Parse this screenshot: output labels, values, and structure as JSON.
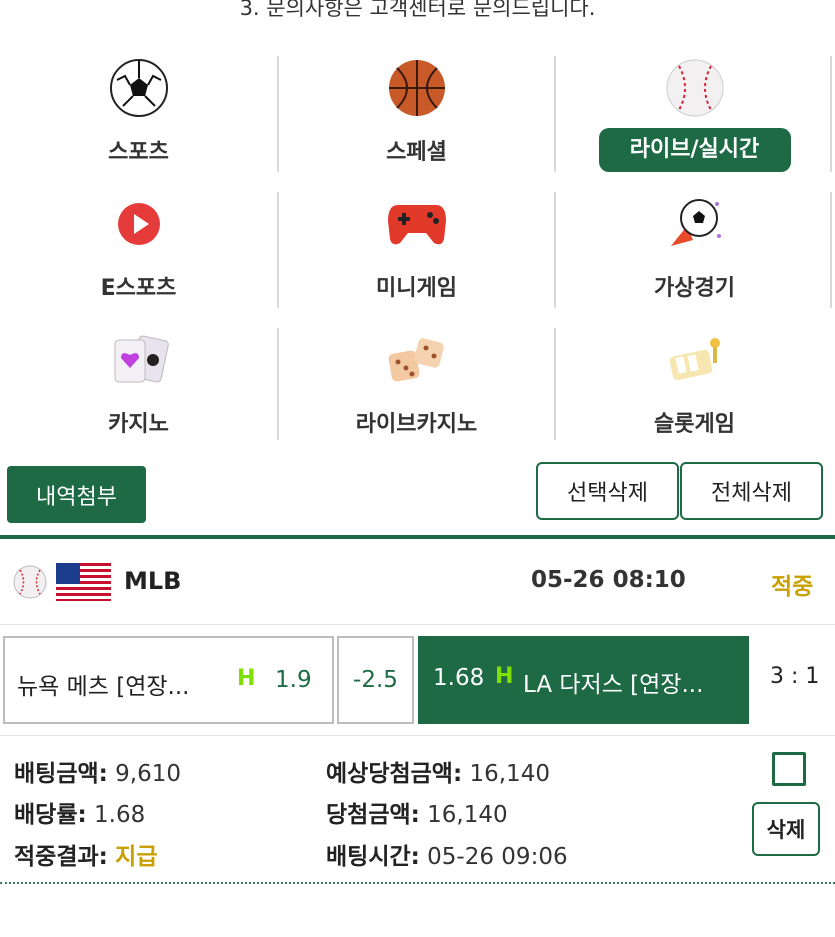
{
  "notice": "3. 문의사항은 고객센터로 문의드립니다.",
  "categories": [
    {
      "label": "스포츠",
      "icon": "soccer-ball-icon",
      "active": false
    },
    {
      "label": "스페셜",
      "icon": "basketball-icon",
      "active": false
    },
    {
      "label": "라이브/실시간",
      "icon": "baseball-icon",
      "active": true
    },
    {
      "label": "E스포츠",
      "icon": "play-icon",
      "active": false
    },
    {
      "label": "미니게임",
      "icon": "gamepad-icon",
      "active": false
    },
    {
      "label": "가상경기",
      "icon": "virtual-soccer-icon",
      "active": false
    },
    {
      "label": "카지노",
      "icon": "cards-icon",
      "active": false
    },
    {
      "label": "라이브카지노",
      "icon": "dice-icon",
      "active": false
    },
    {
      "label": "슬롯게임",
      "icon": "slot-icon",
      "active": false
    }
  ],
  "actions": {
    "history": "내역첨부",
    "delete_selected": "선택삭제",
    "delete_all": "전체삭제"
  },
  "match": {
    "league": "MLB",
    "datetime": "05-26 08:10",
    "state": "적중",
    "home_team": "뉴욕 메츠 [연장...",
    "home_badge": "H",
    "home_odd": "1.9",
    "handicap": "-2.5",
    "away_odd": "1.68",
    "away_badge": "H",
    "away_team": "LA 다저스 [연장...",
    "score": "3 : 1"
  },
  "bet": {
    "amount_label": "배팅금액:",
    "amount": "9,610",
    "odds_label": "배당률:",
    "odds": "1.68",
    "result_label": "적중결과:",
    "result": "지급",
    "expected_label": "예상당첨금액:",
    "expected": "16,140",
    "win_label": "당첨금액:",
    "win": "16,140",
    "time_label": "배팅시간:",
    "time": "05-26 09:06",
    "delete": "삭제"
  },
  "colors": {
    "brand": "#1d6a44",
    "highlight": "#c8a000",
    "badge": "#7fe000"
  }
}
